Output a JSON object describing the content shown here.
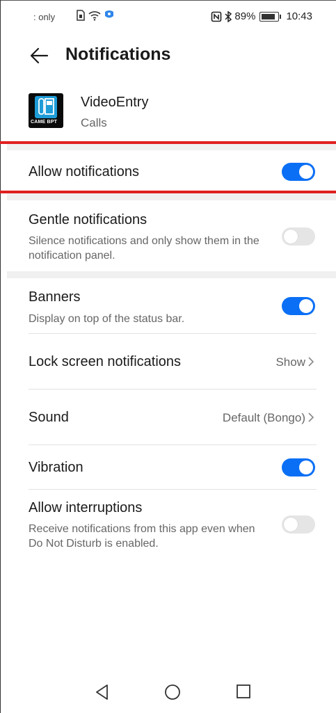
{
  "status_bar": {
    "carrier_text": ": only",
    "battery_percent": "89%",
    "time": "10:43"
  },
  "header": {
    "title": "Notifications"
  },
  "app": {
    "name": "VideoEntry",
    "category": "Calls",
    "icon_brand_text": "CAME BPT"
  },
  "settings": {
    "allow_notifications": {
      "label": "Allow notifications",
      "enabled": true
    },
    "gentle_notifications": {
      "label": "Gentle notifications",
      "description": "Silence notifications and only show them in the notification panel.",
      "enabled": false
    },
    "banners": {
      "label": "Banners",
      "description": "Display on top of the status bar.",
      "enabled": true
    },
    "lock_screen": {
      "label": "Lock screen notifications",
      "value": "Show"
    },
    "sound": {
      "label": "Sound",
      "value": "Default (Bongo)"
    },
    "vibration": {
      "label": "Vibration",
      "enabled": true
    },
    "allow_interruptions": {
      "label": "Allow interruptions",
      "description": "Receive notifications from this app even when Do Not Disturb is enabled.",
      "enabled": false
    }
  },
  "colors": {
    "toggle_on": "#0a6ff5",
    "toggle_off": "#e5e5e5",
    "highlight_red": "#e02020"
  },
  "nav": {
    "icons": [
      "back-icon",
      "home-icon",
      "recents-icon"
    ]
  }
}
